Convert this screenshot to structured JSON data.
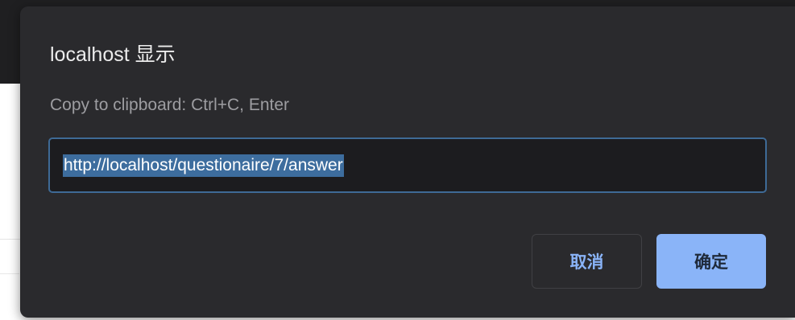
{
  "dialog": {
    "title": "localhost 显示",
    "message": "Copy to clipboard: Ctrl+C, Enter",
    "input_value": "http://localhost/questionaire/7/answer",
    "cancel_label": "取消",
    "ok_label": "确定"
  },
  "colors": {
    "accent": "#8ab4f8",
    "dialog_background": "#2a2a2d",
    "selection": "#3d6d9e"
  }
}
